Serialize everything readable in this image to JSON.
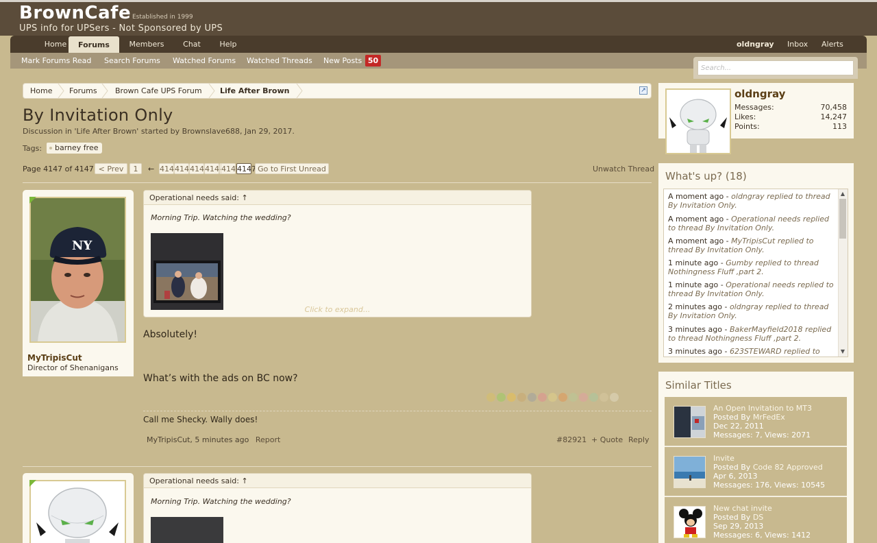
{
  "header": {
    "logo": "BrownCafe",
    "established": "Established in 1999",
    "tagline": "UPS info for UPSers - Not Sponsored by UPS"
  },
  "nav": {
    "tabs": [
      "Home",
      "Forums",
      "Members",
      "Chat",
      "Help"
    ],
    "active_tab": "Forums",
    "user": "oldngray",
    "inbox": "Inbox",
    "alerts": "Alerts"
  },
  "subnav": {
    "items": [
      "Mark Forums Read",
      "Search Forums",
      "Watched Forums",
      "Watched Threads",
      "New Posts"
    ],
    "new_posts_count": "50"
  },
  "search": {
    "placeholder": "Search..."
  },
  "breadcrumb": [
    "Home",
    "Forums",
    "Brown Cafe UPS Forum",
    "Life After Brown"
  ],
  "thread": {
    "title": "By Invitation Only",
    "description": "Discussion in 'Life After Brown' started by Brownslave688, Jan 29, 2017.",
    "tags_label": "Tags:",
    "tags": [
      "barney free"
    ],
    "unwatch": "Unwatch Thread"
  },
  "pagination": {
    "label": "Page 4147 of 4147",
    "prev": "< Prev",
    "first": "1",
    "arrow": "←",
    "pages": [
      "4141",
      "4142",
      "4143",
      "4144",
      "4145",
      "4146",
      "4147"
    ],
    "go_first_unread": "Go to First Unread"
  },
  "posts": [
    {
      "username": "MyTripisCut",
      "user_title": "Director of Shenanigans",
      "quote_author": "Operational needs said: ↑",
      "quote_text": "Morning Trip. Watching the wedding?",
      "expand": "Click to expand...",
      "message_1": "Absolutely!",
      "message_2": "What’s with the ads on BC now?",
      "signature": "Call me Shecky. Wally does!",
      "meta_author": "MyTripisCut",
      "meta_time": ", 5 minutes ago",
      "report": "Report",
      "post_number": "#82921",
      "quote": "+ Quote",
      "reply": "Reply"
    },
    {
      "quote_author": "Operational needs said: ↑",
      "quote_text": "Morning Trip. Watching the wedding?"
    }
  ],
  "sidebar": {
    "profile": {
      "name": "oldngray",
      "stats": [
        {
          "label": "Messages:",
          "value": "70,458"
        },
        {
          "label": "Likes:",
          "value": "14,247"
        },
        {
          "label": "Points:",
          "value": "113"
        }
      ]
    },
    "whats_up": {
      "title": "What's up? (18)",
      "items": [
        {
          "time": "A moment ago",
          "text": "oldngray replied to thread By Invitation Only."
        },
        {
          "time": "A moment ago",
          "text": "Operational needs replied to thread By Invitation Only."
        },
        {
          "time": "A moment ago",
          "text": "MyTripisCut replied to thread By Invitation Only."
        },
        {
          "time": "1 minute ago",
          "text": "Gumby replied to thread Nothingness Fluff ,part 2."
        },
        {
          "time": "1 minute ago",
          "text": "Operational needs replied to thread By Invitation Only."
        },
        {
          "time": "2 minutes ago",
          "text": "oldngray replied to thread By Invitation Only."
        },
        {
          "time": "3 minutes ago",
          "text": "BakerMayfield2018 replied to thread Nothingness Fluff ,part 2."
        },
        {
          "time": "3 minutes ago",
          "text": "623STEWARD replied to"
        }
      ]
    },
    "similar": {
      "title": "Similar Titles",
      "items": [
        {
          "title": "An Open Invitation to MT3",
          "posted_by": "Posted By",
          "author": "MrFedEx",
          "date": "Dec 22, 2011",
          "stats": "Messages: 7, Views: 2071"
        },
        {
          "title": "Invite",
          "posted_by": "Posted By",
          "author": "Code 82 Approved",
          "date": "Apr 6, 2013",
          "stats": "Messages: 176, Views: 10545"
        },
        {
          "title": "New chat invite",
          "posted_by": "Posted By",
          "author": "DS",
          "date": "Sep 29, 2013",
          "stats": "Messages: 6, Views: 1412"
        }
      ]
    }
  }
}
